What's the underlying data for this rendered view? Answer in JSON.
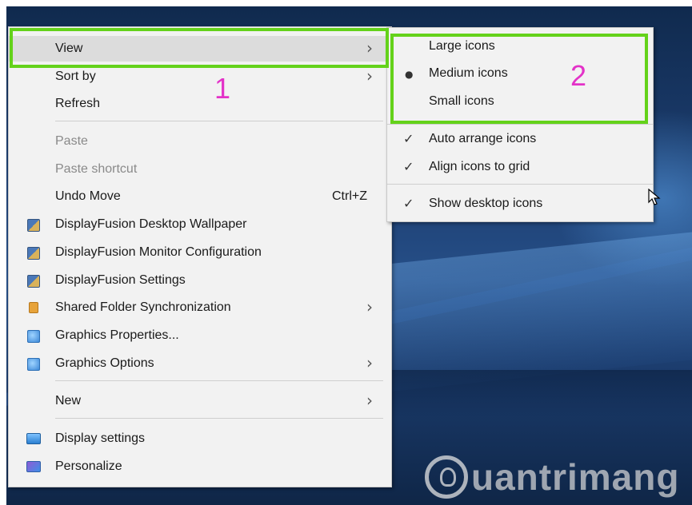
{
  "context_menu": {
    "items": [
      {
        "label": "View",
        "submenu": true
      },
      {
        "label": "Sort by",
        "submenu": true
      },
      {
        "label": "Refresh"
      },
      {
        "label": "Paste",
        "disabled": true
      },
      {
        "label": "Paste shortcut",
        "disabled": true
      },
      {
        "label": "Undo Move",
        "shortcut": "Ctrl+Z"
      },
      {
        "label": "DisplayFusion Desktop Wallpaper",
        "icon": "displayfusion-icon"
      },
      {
        "label": "DisplayFusion Monitor Configuration",
        "icon": "displayfusion-icon"
      },
      {
        "label": "DisplayFusion Settings",
        "icon": "displayfusion-icon"
      },
      {
        "label": "Shared Folder Synchronization",
        "icon": "shared-folder-icon",
        "submenu": true
      },
      {
        "label": "Graphics Properties...",
        "icon": "graphics-icon"
      },
      {
        "label": "Graphics Options",
        "icon": "graphics-icon",
        "submenu": true
      },
      {
        "label": "New",
        "submenu": true
      },
      {
        "label": "Display settings",
        "icon": "display-settings-icon"
      },
      {
        "label": "Personalize",
        "icon": "personalize-icon"
      }
    ],
    "arrow_glyph": "›"
  },
  "view_submenu": {
    "items": [
      {
        "label": "Large icons"
      },
      {
        "label": "Medium icons",
        "mark": "●"
      },
      {
        "label": "Small icons"
      },
      {
        "label": "Auto arrange icons",
        "mark": "✓"
      },
      {
        "label": "Align icons to grid",
        "mark": "✓"
      },
      {
        "label": "Show desktop icons",
        "mark": "✓"
      }
    ]
  },
  "annotations": {
    "callout_1": "1",
    "callout_2": "2",
    "highlight_color": "#64d21a",
    "callout_color": "#e332c8"
  },
  "watermark": {
    "text": "uantrimang"
  }
}
